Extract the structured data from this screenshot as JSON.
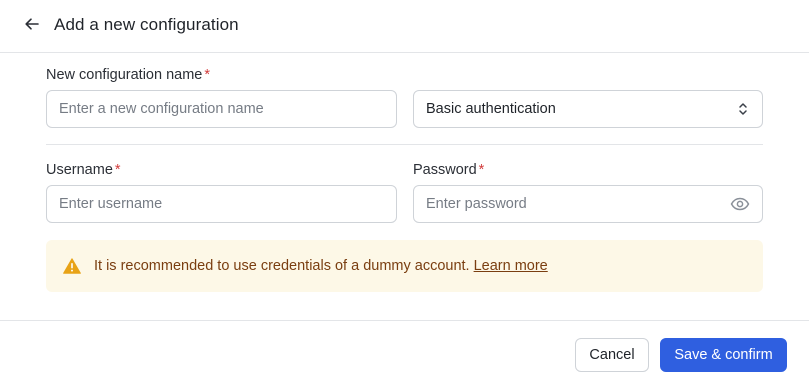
{
  "header": {
    "back_icon": "arrow-left-icon",
    "title": "Add a new configuration"
  },
  "form": {
    "config_name": {
      "label": "New configuration name",
      "required_mark": "*",
      "placeholder": "Enter a new configuration name",
      "value": ""
    },
    "auth_type": {
      "selected": "Basic authentication",
      "icon": "chevron-up-down-icon"
    },
    "username": {
      "label": "Username",
      "required_mark": "*",
      "placeholder": "Enter username",
      "value": ""
    },
    "password": {
      "label": "Password",
      "required_mark": "*",
      "placeholder": "Enter password",
      "value": "",
      "toggle_icon": "eye-icon"
    }
  },
  "warning": {
    "icon": "warning-triangle-icon",
    "text": "It is recommended to use credentials of a dummy account.",
    "link": "Learn more",
    "background": "#fdf8e7",
    "icon_color": "#e8a317",
    "text_color": "#7a3e10"
  },
  "footer": {
    "cancel_label": "Cancel",
    "confirm_label": "Save & confirm",
    "primary_color": "#2f5fe0"
  }
}
